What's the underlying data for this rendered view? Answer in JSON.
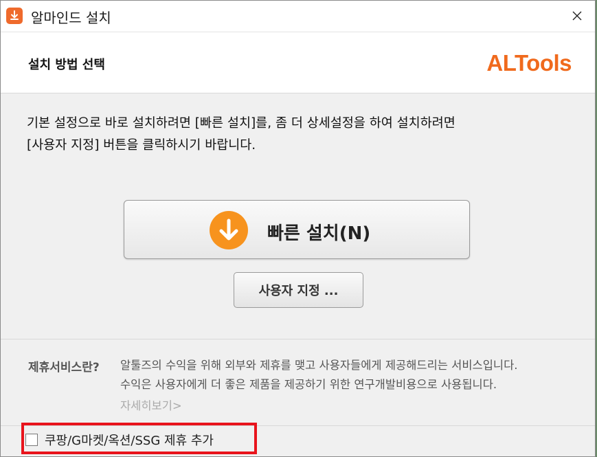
{
  "window": {
    "title": "알마인드 설치",
    "app_icon": "download-arrow-icon",
    "close_icon": "close-icon"
  },
  "header": {
    "section_title": "설치 방법 선택",
    "brand": "ALTools",
    "brand_color": "#f06a1d"
  },
  "description": {
    "line1": "기본 설정으로 바로 설치하려면 [빠른 설치]를, 좀 더 상세설정을 하여 설치하려면",
    "line2": "[사용자 지정] 버튼을 클릭하시기 바랍니다."
  },
  "buttons": {
    "quick_install": "빠른 설치(N)",
    "quick_icon": "down-arrow-circle-icon",
    "quick_icon_color": "#f7931e",
    "custom": "사용자 지정 ..."
  },
  "partner": {
    "label": "제휴서비스란?",
    "text_line1": "알툴즈의 수익을 위해 외부와 제휴를 맺고 사용자들에게 제공해드리는 서비스입니다.",
    "text_line2": "수익은 사용자에게 더 좋은 제품을 제공하기 위한 연구개발비용으로 사용됩니다.",
    "details_link": "자세히보기>"
  },
  "checkbox": {
    "label": "쿠팡/G마켓/옥션/SSG 제휴 추가",
    "checked": false,
    "highlight_color": "#e8141c"
  }
}
